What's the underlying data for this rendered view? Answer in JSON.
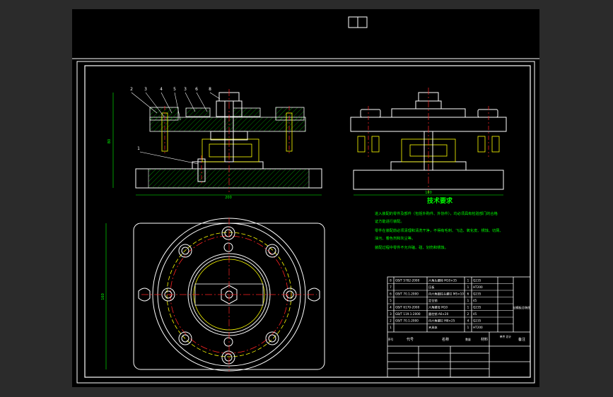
{
  "colors": {
    "window_bg": "#2b2b2b",
    "drawing_bg": "#000000",
    "line_white": "#ffffff",
    "line_green": "#00ff00",
    "line_red": "#ff2a2a",
    "line_yellow": "#ffff00",
    "line_cyan": "#00ffff"
  },
  "icons": {
    "top_marker": "drawing-marker-icon"
  },
  "front_view": {
    "callouts": [
      "2",
      "3",
      "4",
      "5",
      "3",
      "6",
      "8",
      "1"
    ],
    "dims": {
      "width": "200",
      "height": "80"
    }
  },
  "side_view": {
    "dims": {
      "width": "180"
    }
  },
  "plan_view": {
    "dims": {
      "height": "160"
    }
  },
  "tech_req": {
    "title": "技术要求",
    "lines": [
      "进入装配的零件及部件（包括外购件、外协件），均必须具有检验部门的合格",
      "证方能进行装配。",
      "零件在装配前必须清理和清洗干净，不得有毛刺、飞边、氧化皮、锈蚀、切屑、",
      "油污、着色剂和灰尘等。",
      "装配过程中零件不允许磕、碰、划伤和锈蚀。"
    ]
  },
  "bom": {
    "rows": [
      {
        "no": "8",
        "code": "GB/T 5782-2000",
        "name": "六角头螺栓 M10×35",
        "qty": "1",
        "material": "Q235"
      },
      {
        "no": "7",
        "code": "",
        "name": "压板",
        "qty": "1",
        "material": "HT200"
      },
      {
        "no": "6",
        "code": "GB/T 70.1-2000",
        "name": "内六角圆柱头螺钉 M5×10",
        "qty": "6",
        "material": "Q235"
      },
      {
        "no": "5",
        "code": "",
        "name": "定位销",
        "qty": "1",
        "material": "45"
      },
      {
        "no": "4",
        "code": "GB/T 6170-2000",
        "name": "六角螺母 M10",
        "qty": "1",
        "material": "Q235"
      },
      {
        "no": "3",
        "code": "GB/T 119.1-2000",
        "name": "圆柱销 A6×20",
        "qty": "2",
        "material": "45"
      },
      {
        "no": "2",
        "code": "GB/T 70.1-2000",
        "name": "内六角螺钉 M8×25",
        "qty": "4",
        "material": "Q235"
      },
      {
        "no": "1",
        "code": "",
        "name": "夹具体",
        "qty": "1",
        "material": "HT200"
      }
    ],
    "header": {
      "no": "序号",
      "code": "代号",
      "name": "名称",
      "qty": "数量",
      "material": "材料",
      "weight": "单件 总计",
      "note": "备注"
    },
    "side_note": "钻模板总装图"
  }
}
